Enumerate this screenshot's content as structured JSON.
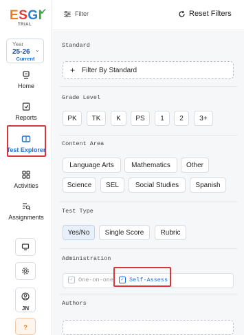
{
  "sidebar": {
    "logo": {
      "text": "ESGI",
      "sub": "TRIAL"
    },
    "year": {
      "label": "Year",
      "value": "25-26",
      "current": "Current"
    },
    "nav": [
      {
        "label": "Home",
        "icon": "home-icon"
      },
      {
        "label": "Reports",
        "icon": "reports-icon"
      },
      {
        "label": "Test Explorer",
        "icon": "test-explorer-icon",
        "active": true
      },
      {
        "label": "Activities",
        "icon": "activities-icon"
      },
      {
        "label": "Assignments",
        "icon": "assignments-icon"
      }
    ],
    "tools": [
      {
        "icon": "monitor-icon"
      },
      {
        "icon": "settings-gear-icon"
      }
    ],
    "user": {
      "initials": "JN",
      "icon": "user-icon"
    },
    "help": {
      "label": "?"
    }
  },
  "topbar": {
    "filter_label": "Filter",
    "reset_label": "Reset Filters"
  },
  "filters": {
    "standard": {
      "title": "Standard",
      "button": "Filter By Standard"
    },
    "grade_level": {
      "title": "Grade Level",
      "options": [
        "PK",
        "TK",
        "K",
        "PS",
        "1",
        "2",
        "3+"
      ]
    },
    "content_area": {
      "title": "Content Area",
      "row1": [
        "Language Arts",
        "Mathematics",
        "Other"
      ],
      "row2": [
        "Science",
        "SEL",
        "Social Studies",
        "Spanish"
      ]
    },
    "test_type": {
      "title": "Test Type",
      "options": [
        "Yes/No",
        "Single Score",
        "Rubric"
      ],
      "selected": "Yes/No"
    },
    "administration": {
      "title": "Administration",
      "options": [
        {
          "label": "One-on-one",
          "checked": true,
          "disabled": true
        },
        {
          "label": "Self-Assess",
          "checked": true
        }
      ]
    },
    "authors": {
      "title": "Authors"
    }
  },
  "colors": {
    "accent": "#1e6fd3",
    "highlight": "#d9343a",
    "panel_bg": "#f6f7f9"
  }
}
